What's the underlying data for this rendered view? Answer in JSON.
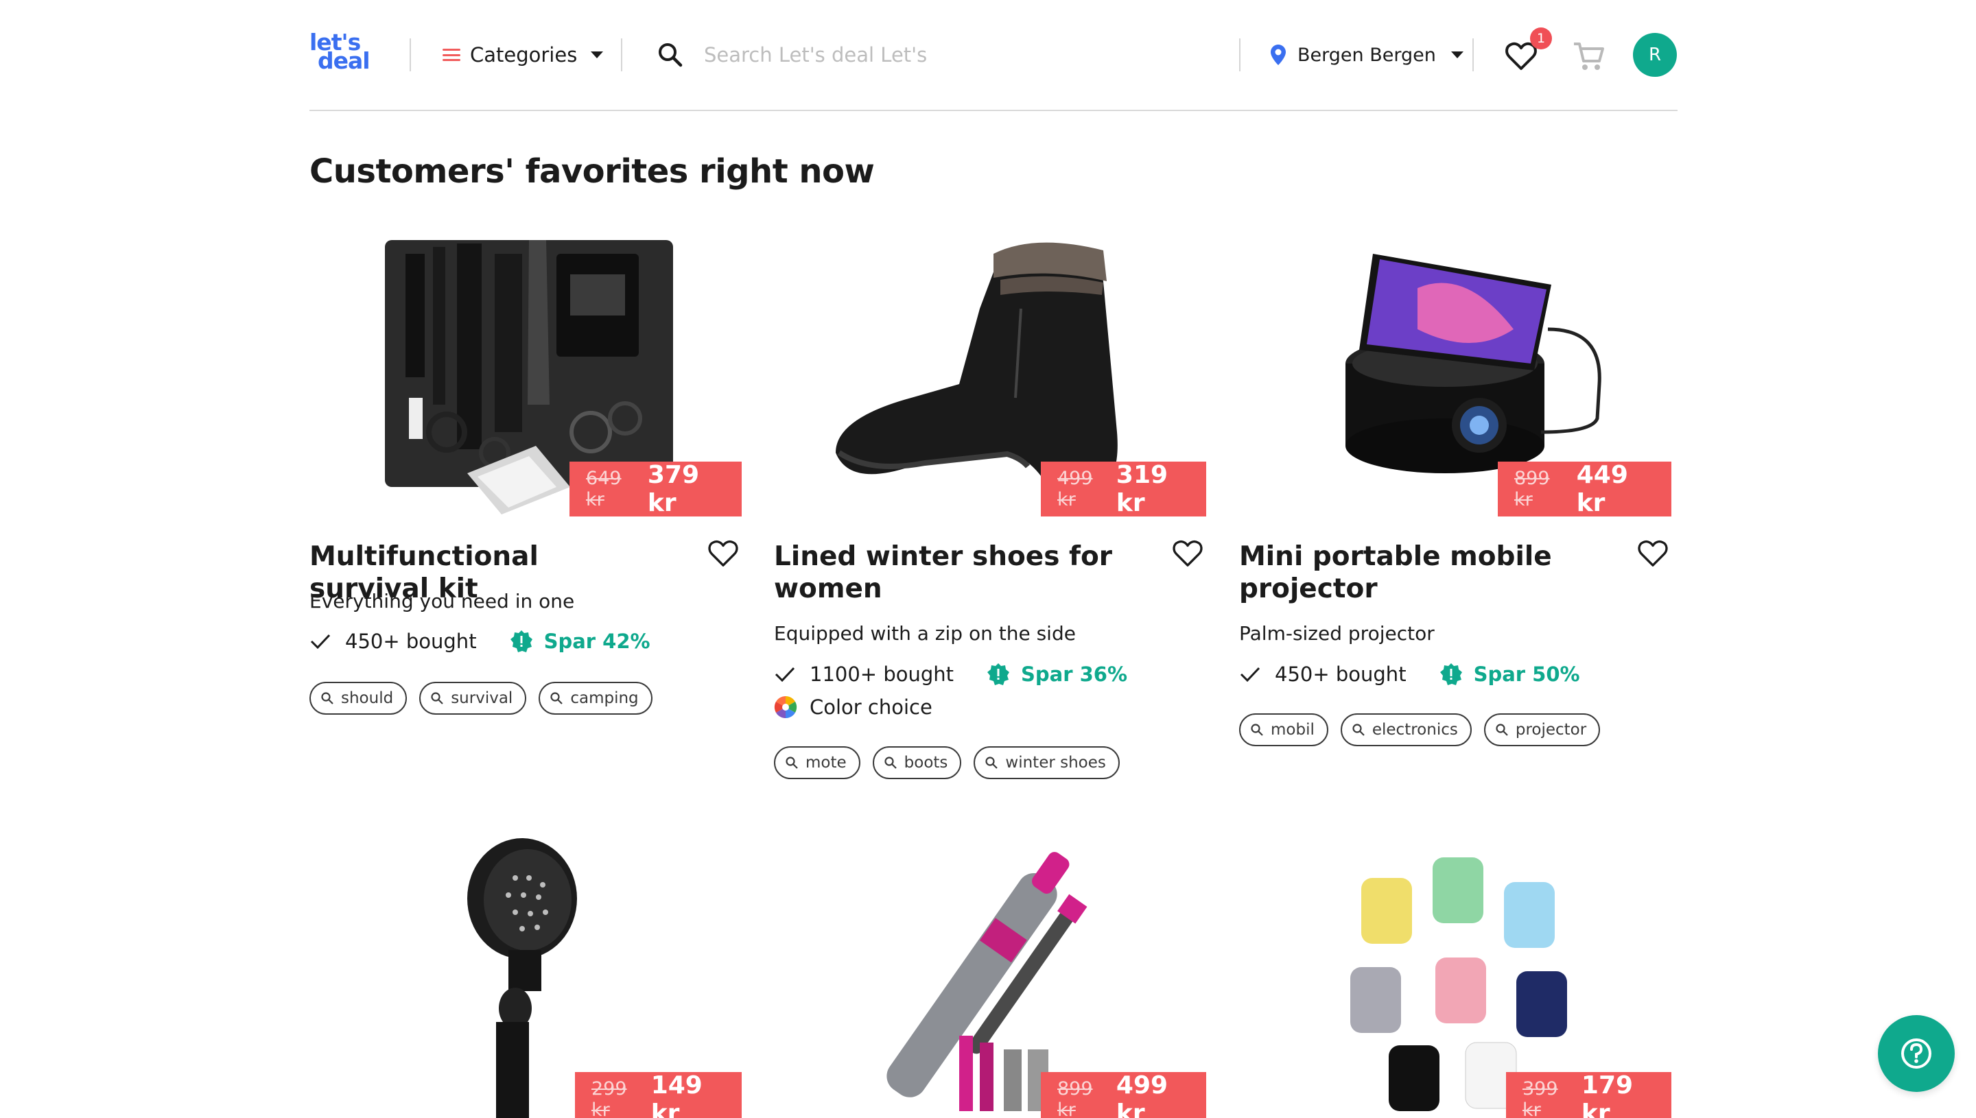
{
  "header": {
    "logo_line1": "let's",
    "logo_line2": "deal",
    "categories_label": "Categories",
    "search_placeholder": "Search Let's deal Let's",
    "location_label": "Bergen Bergen",
    "wishlist_count": "1",
    "avatar_initial": "R"
  },
  "main": {
    "title": "Customers' favorites right now",
    "products": [
      {
        "title": "Multifunctional survival kit",
        "subtitle": "Everything you need in one",
        "old_price": "649 kr",
        "new_price": "379 kr",
        "bought": "450+ bought",
        "spar": "Spar 42%",
        "tags": [
          "should",
          "survival",
          "camping"
        ]
      },
      {
        "title": "Lined winter shoes for women",
        "subtitle": "Equipped with a zip on the side",
        "old_price": "499 kr",
        "new_price": "319 kr",
        "bought": "1100+ bought",
        "spar": "Spar 36%",
        "color_choice": "Color choice",
        "tags": [
          "mote",
          "boots",
          "winter shoes"
        ]
      },
      {
        "title": "Mini portable mobile projector",
        "subtitle": "Palm-sized projector",
        "old_price": "899 kr",
        "new_price": "449 kr",
        "bought": "450+ bought",
        "spar": "Spar 50%",
        "tags": [
          "mobil",
          "electronics",
          "projector"
        ]
      },
      {
        "old_price": "299 kr",
        "new_price": "149 kr"
      },
      {
        "old_price": "899 kr",
        "new_price": "499 kr"
      },
      {
        "old_price": "399 kr",
        "new_price": "179 kr"
      }
    ]
  },
  "colors": {
    "accent_red": "#f2585a",
    "brand_blue": "#3a6ff0",
    "green": "#0fa98d"
  },
  "icons": {
    "categories": "hamburger-icon",
    "search": "search-icon",
    "location": "location-pin-icon",
    "wishlist": "heart-icon",
    "cart": "cart-icon",
    "help": "help-icon"
  }
}
